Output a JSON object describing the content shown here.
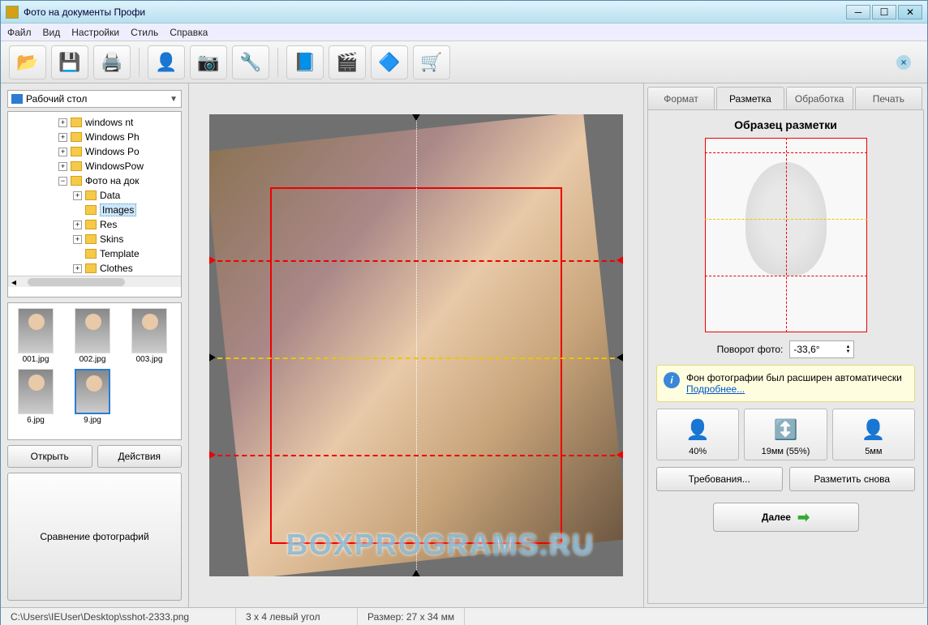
{
  "window": {
    "title": "Фото на документы Профи"
  },
  "menu": {
    "file": "Файл",
    "view": "Вид",
    "settings": "Настройки",
    "style": "Стиль",
    "help": "Справка"
  },
  "sidebar": {
    "location": "Рабочий стол",
    "tree": {
      "n0": "windows nt",
      "n1": "Windows Ph",
      "n2": "Windows Po",
      "n3": "WindowsPow",
      "n4": "Фото на док",
      "n5": "Data",
      "n6": "Images",
      "n7": "Res",
      "n8": "Skins",
      "n9": "Template",
      "n10": "Clothes"
    },
    "thumbs": [
      {
        "name": "001.jpg"
      },
      {
        "name": "002.jpg"
      },
      {
        "name": "003.jpg"
      },
      {
        "name": "6.jpg"
      },
      {
        "name": "9.jpg"
      }
    ],
    "open": "Открыть",
    "actions": "Действия",
    "compare": "Сравнение фотографий"
  },
  "right": {
    "tabs": {
      "format": "Формат",
      "markup": "Разметка",
      "process": "Обработка",
      "print": "Печать"
    },
    "sample_title": "Образец разметки",
    "rotate_label": "Поворот фото:",
    "rotate_value": "-33,6°",
    "info_text": "Фон фотографии был расширен автоматически",
    "info_link": "Подробнее...",
    "metrics": {
      "m1": "40%",
      "m2": "19мм (55%)",
      "m3": "5мм"
    },
    "requirements": "Требования...",
    "remark": "Разметить снова",
    "next": "Далее"
  },
  "status": {
    "path": "C:\\Users\\IEUser\\Desktop\\sshot-2333.png",
    "corner": "3 x 4 левый угол",
    "size": "Размер: 27 x 34 мм"
  },
  "watermark": "BOXPROGRAMS.RU"
}
